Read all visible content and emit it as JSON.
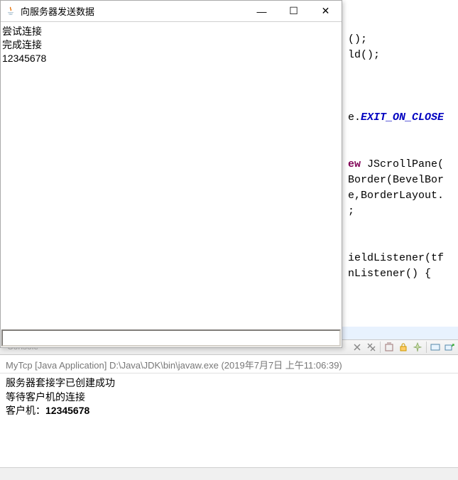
{
  "client": {
    "title": "向服务器发送数据",
    "lines": [
      "尝试连接",
      "完成连接",
      "12345678"
    ],
    "input_value": ""
  },
  "code": {
    "frag1": "();",
    "frag2": "ld();",
    "frag3_pre": "e.",
    "frag3_const": "EXIT_ON_CLOSE",
    "frag4_kw": "ew",
    "frag4_rest": " JScrollPane(",
    "frag5": "Border(BevelBor",
    "frag6": "e,BorderLayout.",
    "frag7": ";",
    "frag8": "ieldListener(tf",
    "frag9": "nListener() {"
  },
  "console": {
    "tab_frag": "Console",
    "run_desc": "MyTcp [Java Application] D:\\Java\\JDK\\bin\\javaw.exe (2019年7月7日 上午11:06:39)",
    "out_line1": "服务器套接字已创建成功",
    "out_line2": "等待客户机的连接",
    "out_line3_prefix": "客户机：",
    "out_line3_bold": "12345678"
  },
  "winctl": {
    "minimize": "—",
    "maximize": "☐",
    "close": "✕"
  }
}
